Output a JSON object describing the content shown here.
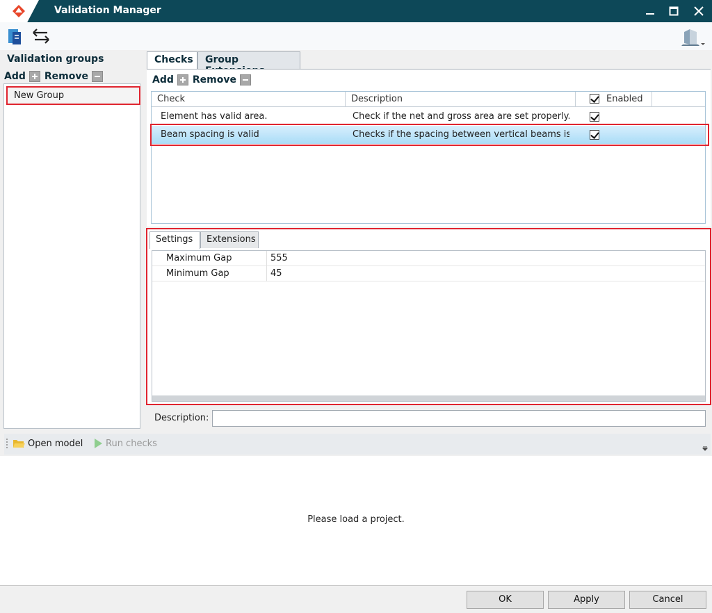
{
  "window": {
    "title": "Validation Manager",
    "controls": [
      "minimize-icon",
      "maximize-icon",
      "close-icon"
    ],
    "accent": "#0d4858"
  },
  "toolbar": {
    "icons": [
      "book-icon",
      "arrows-exchange-icon",
      "building-icon"
    ]
  },
  "left": {
    "title": "Validation groups",
    "add_label": "Add",
    "remove_label": "Remove",
    "groups": [
      {
        "name": "New Group"
      }
    ]
  },
  "tabs": [
    {
      "label": "Checks",
      "active": true
    },
    {
      "label": "Group Extensions",
      "active": false
    }
  ],
  "checks": {
    "add_label": "Add",
    "remove_label": "Remove",
    "columns": {
      "check": "Check",
      "description": "Description",
      "enabled": "Enabled"
    },
    "rows": [
      {
        "check": "Element has valid area.",
        "description": "Check if the net and gross area are set properly.",
        "enabled": true,
        "selected": false
      },
      {
        "check": "Beam spacing is valid",
        "description": "Checks if the spacing between vertical beams is wit",
        "enabled": true,
        "selected": true
      }
    ]
  },
  "settings": {
    "tabs": [
      {
        "label": "Settings",
        "active": true
      },
      {
        "label": "Extensions",
        "active": false
      }
    ],
    "properties": [
      {
        "name": "Maximum Gap",
        "value": "555"
      },
      {
        "name": "Minimum Gap",
        "value": "45"
      }
    ]
  },
  "description": {
    "label": "Description:",
    "value": ""
  },
  "bottom": {
    "open_model": "Open model",
    "run_checks": "Run checks"
  },
  "output": {
    "message": "Please load a project."
  },
  "footer": {
    "ok": "OK",
    "apply": "Apply",
    "cancel": "Cancel"
  },
  "colors": {
    "highlight": "#e0242f",
    "selection": "#a9dcf7"
  }
}
